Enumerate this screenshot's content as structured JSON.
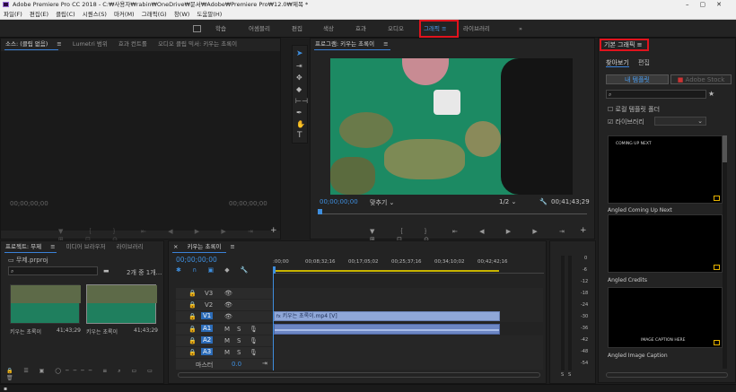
{
  "app": {
    "title": "Adobe Premiere Pro CC 2018 - C:₩사용자₩rabin₩OneDrive₩문서₩Adobe₩Premiere Pro₩12.0₩제목 *"
  },
  "menu": [
    "파일(F)",
    "편집(E)",
    "클립(C)",
    "시퀀스(S)",
    "마커(M)",
    "그래픽(G)",
    "창(W)",
    "도움말(H)"
  ],
  "workspaces": [
    "학습",
    "어셈블리",
    "편집",
    "색상",
    "효과",
    "오디오",
    "그래픽",
    "라이브러리"
  ],
  "active_workspace": "그래픽",
  "workspace_overflow": "»",
  "source_panel": {
    "tabs": [
      "소스: (클립 없음)",
      "Lumetri 범위",
      "효과 컨트롤",
      "오디오 클립 믹서: 키우는 초록이"
    ],
    "timecode_left": "00;00;00;00",
    "timecode_right": "00;00;00;00"
  },
  "program_panel": {
    "title": "프로그램: 키우는 초록이",
    "timecode": "00;00;00;00",
    "fit": "맞추기",
    "resolution": "1/2",
    "duration": "00;41;43;29"
  },
  "essential_graphics": {
    "title": "기본 그래픽",
    "tabs": [
      "찾아보기",
      "편집"
    ],
    "my_templates": "내 템플릿",
    "adobe_stock": "Adobe Stock",
    "checkboxes": [
      "로컬 템플릿 폴더",
      "라이브러리"
    ],
    "templates": [
      {
        "name": "Angled Coming Up Next",
        "text": "COMING UP NEXT"
      },
      {
        "name": "Angled Credits",
        "text": ""
      },
      {
        "name": "Angled Image Caption",
        "text": "IMAGE CAPTION HERE"
      }
    ]
  },
  "project_panel": {
    "tabs": [
      "프로젝트: 무제",
      "미디어 브라우저",
      "라이브러리"
    ],
    "file": "무제.prproj",
    "count": "2개 중 1개...",
    "items": [
      {
        "name": "키우는 초록이",
        "duration": "41;43;29"
      },
      {
        "name": "키우는 초록이",
        "duration": "41;43;29"
      }
    ]
  },
  "timeline": {
    "title": "키우는 초록이",
    "timecode": "00;00;00;00",
    "ruler": [
      ":00;00",
      "00;08;32;16",
      "00;17;05;02",
      "00;25;37;16",
      "00;34;10;02",
      "00;42;42;16"
    ],
    "video_tracks": [
      "V3",
      "V2",
      "V1"
    ],
    "audio_tracks": [
      "A1",
      "A2",
      "A3"
    ],
    "master": "마스터",
    "master_value": "0.0",
    "clip_label": "키우는 초록이.mp4 [V]"
  },
  "meter": {
    "scale": [
      "0",
      "-6",
      "-12",
      "-18",
      "-24",
      "-30",
      "-36",
      "-42",
      "-48",
      "-54"
    ],
    "solo": [
      "S",
      "S"
    ]
  }
}
